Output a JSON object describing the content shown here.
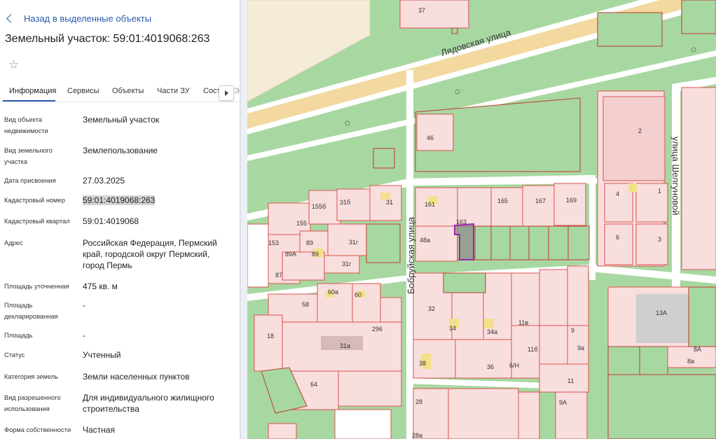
{
  "nav": {
    "back_label": "Назад в выделенные объекты"
  },
  "header": {
    "title": "Земельный участок: 59:01:4019068:263"
  },
  "tabs": [
    {
      "label": "Информация"
    },
    {
      "label": "Сервисы"
    },
    {
      "label": "Объекты"
    },
    {
      "label": "Части ЗУ"
    },
    {
      "label": "Сост"
    }
  ],
  "properties": [
    {
      "label": "Вид объекта недвижимости",
      "value": "Земельный участок"
    },
    {
      "label": "Вид земельного участка",
      "value": "Землепользование"
    },
    {
      "label": "Дата присвоения",
      "value": "27.03.2025"
    },
    {
      "label": "Кадастровый номер",
      "value": "59:01:4019068:263"
    },
    {
      "label": "Кадастровый квартал",
      "value": "59:01:4019068"
    },
    {
      "label": "Адрес",
      "value": "Российская Федерация, Пермский край, городской округ Пермский, город Пермь"
    },
    {
      "label": "Площадь уточненная",
      "value": "475 кв. м"
    },
    {
      "label": "Площадь декларированная",
      "value": "-"
    },
    {
      "label": "Площадь",
      "value": "-"
    },
    {
      "label": "Статус",
      "value": "Учтенный"
    },
    {
      "label": "Категория земель",
      "value": "Земли населенных пунктов"
    },
    {
      "label": "Вид разрешенного использования",
      "value": "Для индивидуального жилищного строительства"
    },
    {
      "label": "Форма собственности",
      "value": "Частная"
    }
  ],
  "map": {
    "streets": {
      "lyadovskaya": "Лядовская улица",
      "bobruyskaya": "Бобруйская улица",
      "shelgunovoy": "улица Шелгуновой"
    },
    "labels": [
      "37",
      "46",
      "2",
      "1",
      "4",
      "3",
      "6",
      "161",
      "163",
      "165",
      "167",
      "169",
      "31",
      "31б",
      "155б",
      "155",
      "153",
      "89",
      "89",
      "89А",
      "31г",
      "31г",
      "87",
      "48а",
      "60а",
      "60",
      "58",
      "296",
      "18",
      "31а",
      "64",
      "32",
      "34",
      "34а",
      "11в",
      "9",
      "9а",
      "11б",
      "38",
      "36",
      "6/Н",
      "11",
      "9А",
      "13А",
      "8А",
      "8а",
      "28",
      "28а"
    ],
    "colors": {
      "background": "#a8d8a2",
      "road": "#ffffff",
      "highway": "#f3d9a0",
      "parcel_fill": "#f9dede",
      "parcel_stroke": "#d9534f",
      "selected_parcel": "#9c27b0"
    }
  }
}
